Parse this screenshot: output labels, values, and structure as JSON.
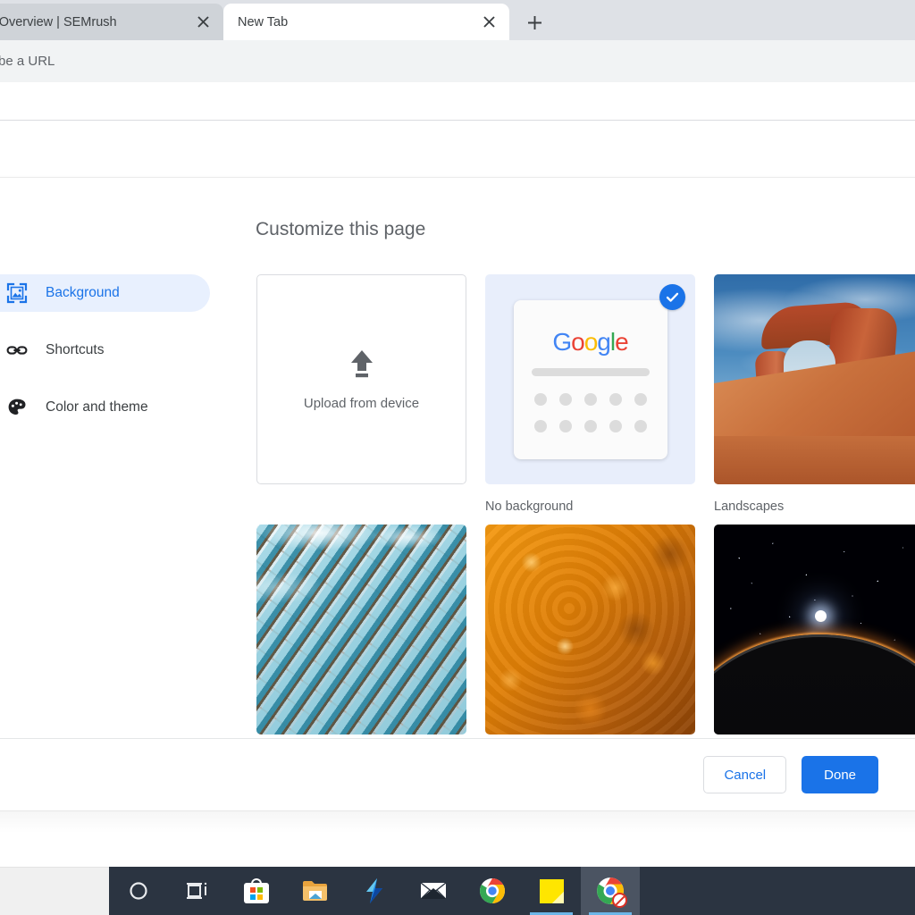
{
  "browser": {
    "tabs": [
      {
        "title": "yword Overview | SEMrush",
        "active": false,
        "close_icon": "close-icon"
      },
      {
        "title": "New Tab",
        "active": true,
        "close_icon": "close-icon"
      }
    ],
    "new_tab_button_icon": "plus-icon",
    "omnibox_text": "be a URL"
  },
  "dialog": {
    "title": "Customize this page",
    "sidebar": {
      "items": [
        {
          "label": "Background",
          "icon": "image-background-icon",
          "active": true
        },
        {
          "label": "Shortcuts",
          "icon": "link-chain-icon",
          "active": false
        },
        {
          "label": "Color and theme",
          "icon": "palette-icon",
          "active": false
        }
      ]
    },
    "tiles": {
      "row1": [
        {
          "kind": "upload",
          "label": "Upload from device",
          "icon": "upload-arrow-icon",
          "caption": "",
          "selected": false
        },
        {
          "kind": "no-background",
          "caption": "No background",
          "selected": true,
          "check_icon": "check-circle-icon",
          "mini_logo": [
            "G",
            "o",
            "o",
            "g",
            "l",
            "e"
          ]
        },
        {
          "kind": "landscapes",
          "caption": "Landscapes",
          "selected": false
        }
      ],
      "row2": [
        {
          "kind": "architecture",
          "caption": "",
          "selected": false
        },
        {
          "kind": "orange-texture",
          "caption": "",
          "selected": false
        },
        {
          "kind": "space",
          "caption": "",
          "selected": false
        }
      ]
    },
    "footer": {
      "cancel_label": "Cancel",
      "done_label": "Done"
    }
  },
  "taskbar": {
    "items": [
      {
        "name": "cortana-circle-icon",
        "label": "",
        "active": false,
        "underline": false
      },
      {
        "name": "task-view-icon",
        "label": "",
        "active": false,
        "underline": false
      },
      {
        "name": "microsoft-store-icon",
        "label": "",
        "active": false,
        "underline": false
      },
      {
        "name": "file-explorer-icon",
        "label": "",
        "active": false,
        "underline": false
      },
      {
        "name": "lightning-bolt-icon",
        "label": "",
        "active": false,
        "underline": false
      },
      {
        "name": "mail-envelope-icon",
        "label": "",
        "active": false,
        "underline": false
      },
      {
        "name": "chrome-icon",
        "label": "",
        "active": false,
        "underline": false
      },
      {
        "name": "sticky-note-icon",
        "label": "",
        "active": false,
        "underline": true
      },
      {
        "name": "chrome-blocked-icon",
        "label": "",
        "active": true,
        "underline": true
      }
    ]
  },
  "colors": {
    "accent_blue": "#1a73e8",
    "tabstrip_gray": "#dee1e6",
    "toolbar_gray": "#f1f3f4",
    "sidebar_active_bg": "#e8f0fe",
    "taskbar_dark": "#2b3441",
    "taskbar_underline": "#6cb6e8"
  }
}
